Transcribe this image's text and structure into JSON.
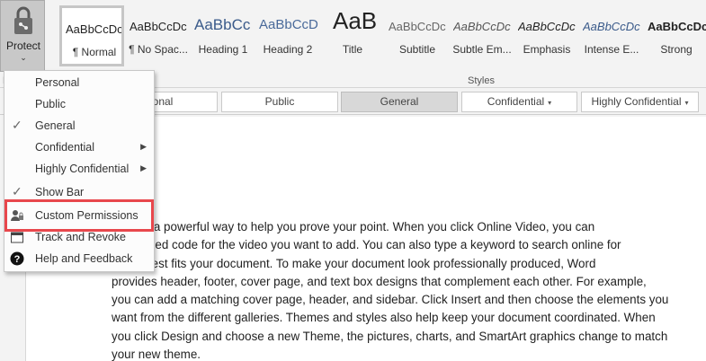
{
  "ribbon": {
    "protect_label": "Protect",
    "protect_group_label": "P",
    "styles_group_label": "Styles",
    "styles": [
      {
        "sample": "AaBbCcDc",
        "name": "¶ Normal",
        "selected": true
      },
      {
        "sample": "AaBbCcDc",
        "name": "¶ No Spac..."
      },
      {
        "sample": "AaBbCc",
        "name": "Heading 1"
      },
      {
        "sample": "AaBbCcD",
        "name": "Heading 2"
      },
      {
        "sample": "AaB",
        "name": "Title"
      },
      {
        "sample": "AaBbCcDc",
        "name": "Subtitle"
      },
      {
        "sample": "AaBbCcDc",
        "name": "Subtle Em..."
      },
      {
        "sample": "AaBbCcDc",
        "name": "Emphasis"
      },
      {
        "sample": "AaBbCcDc",
        "name": "Intense E..."
      },
      {
        "sample": "AaBbCcDc",
        "name": "Strong"
      }
    ]
  },
  "classification_bar": {
    "buttons": [
      {
        "label": "Personal",
        "shown": "rsonal"
      },
      {
        "label": "Public"
      },
      {
        "label": "General",
        "active": true
      },
      {
        "label": "Confidential",
        "has_menu": true
      },
      {
        "label": "Highly Confidential",
        "has_menu": true
      }
    ]
  },
  "menu": {
    "items": [
      {
        "label": "Personal"
      },
      {
        "label": "Public"
      },
      {
        "label": "General",
        "checked": true
      },
      {
        "label": "Confidential",
        "submenu": true
      },
      {
        "label": "Highly Confidential",
        "submenu": true
      },
      {
        "label": "Show Bar",
        "checked": true
      },
      {
        "label": "Custom Permissions",
        "icon": "user-lock-icon",
        "highlighted": true
      },
      {
        "label": "Track and Revoke",
        "icon": "calendar-icon"
      },
      {
        "label": "Help and Feedback",
        "icon": "help-icon"
      }
    ]
  },
  "document": {
    "paragraph_visible_lines": [
      "rovides a powerful way to help you prove your point. When you click Online Video, you can",
      "the embed code for the video you want to add. You can also type a keyword to search online for",
      "o that best fits your document. To make your document look professionally produced, Word",
      "provides header, footer, cover page, and text box designs that complement each other. For example,",
      "you can add a matching cover page, header, and sidebar. Click Insert and then choose the elements you",
      "want from the different galleries. Themes and styles also help keep your document coordinated. When",
      "you click Design and choose a new Theme, the pictures, charts, and SmartArt graphics change to match",
      "your new theme."
    ]
  },
  "colors": {
    "highlight_box": "#e8474c",
    "ribbon_bg": "#f3f3f3",
    "active_button": "#d8d8d8"
  }
}
